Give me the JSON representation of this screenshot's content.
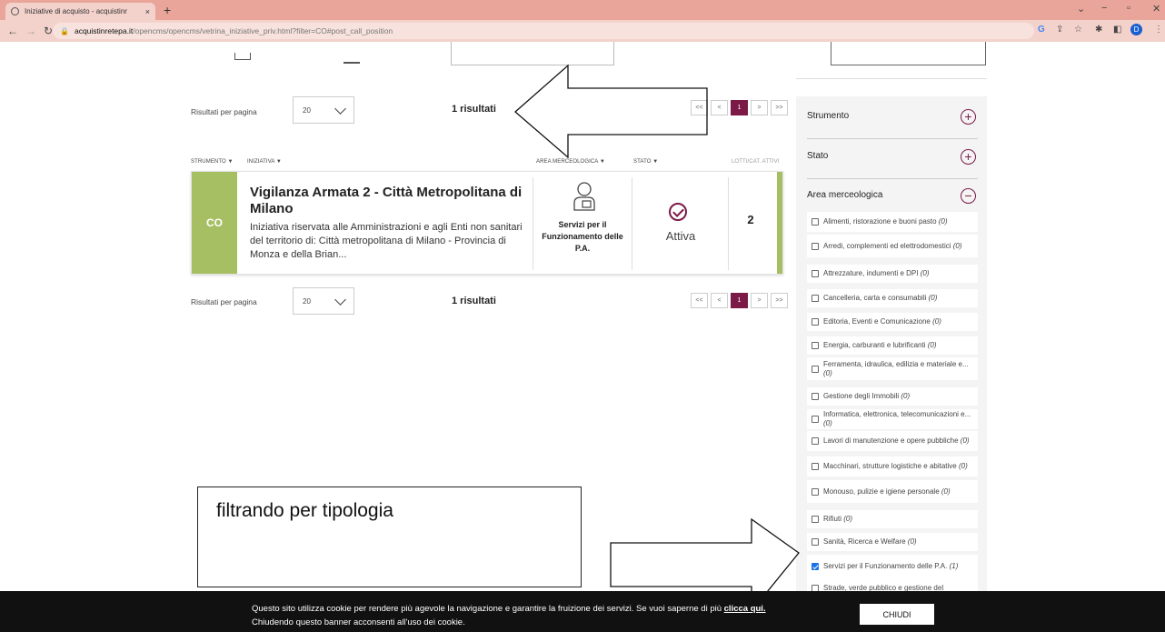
{
  "browser": {
    "tab_title": "Iniziative di acquisto - acquistinr",
    "tab_close": "×",
    "new_tab": "+",
    "url_domain": "acquistinretepa.it",
    "url_path": "/opencms/opencms/vetrina_iniziative_priv.html?filter=CO#post_call_position",
    "profile_initial": "D"
  },
  "results": {
    "per_page_label": "Risultati per pagina",
    "per_page_value": "20",
    "count_label": "1 risultati",
    "pager": [
      "<<",
      "<",
      "1",
      ">",
      ">>"
    ],
    "current_page": "1"
  },
  "columns": {
    "strumento": "STRUMENTO ▼",
    "iniziativa": "INIZIATIVA ▼",
    "area": "AREA MERCEOLOGICA ▼",
    "stato": "STATO ▼",
    "lotti": "LOTTI/CAT. ATTIVI"
  },
  "initiative": {
    "badge": "CO",
    "title": "Vigilanza Armata 2 - Città Metropolitana di Milano",
    "description": "Iniziativa riservata alle Amministrazioni e agli Enti non sanitari del territorio di: Città metropolitana di Milano - Provincia di Monza e della Brian...",
    "area": "Servizi per il Funzionamento delle P.A.",
    "stato": "Attiva",
    "lotti": "2"
  },
  "sidebar": {
    "facets": [
      {
        "label": "Strumento",
        "toggle": "+"
      },
      {
        "label": "Stato",
        "toggle": "+"
      },
      {
        "label": "Area merceologica",
        "toggle": "−"
      }
    ],
    "options": [
      {
        "label": "Alimenti, ristorazione e buoni pasto",
        "count": "(0)",
        "checked": false
      },
      {
        "label": "Arredi, complementi ed elettrodomestici",
        "count": "(0)",
        "checked": false
      },
      {
        "label": "Attrezzature, indumenti e DPI",
        "count": "(0)",
        "checked": false
      },
      {
        "label": "Cancelleria, carta e consumabili",
        "count": "(0)",
        "checked": false
      },
      {
        "label": "Editoria, Eventi e Comunicazione",
        "count": "(0)",
        "checked": false
      },
      {
        "label": "Energia, carburanti e lubrificanti",
        "count": "(0)",
        "checked": false
      },
      {
        "label": "Ferramenta, idraulica, edilizia e materiale e...",
        "count": "(0)",
        "checked": false
      },
      {
        "label": "Gestione degli Immobili",
        "count": "(0)",
        "checked": false
      },
      {
        "label": "Informatica, elettronica, telecomunicazioni e...",
        "count": "(0)",
        "checked": false
      },
      {
        "label": "Lavori di manutenzione e opere pubbliche",
        "count": "(0)",
        "checked": false
      },
      {
        "label": "Macchinari, strutture logistiche e abitative",
        "count": "(0)",
        "checked": false
      },
      {
        "label": "Monouso, pulizie e igiene personale",
        "count": "(0)",
        "checked": false
      },
      {
        "label": "Rifiuti",
        "count": "(0)",
        "checked": false
      },
      {
        "label": "Sanità, Ricerca e Welfare",
        "count": "(0)",
        "checked": false
      },
      {
        "label": "Servizi per il Funzionamento delle P.A.",
        "count": "(1)",
        "checked": true
      },
      {
        "label": "Strade, verde pubblico e gestione del",
        "count": "",
        "checked": false
      }
    ]
  },
  "annotation": {
    "text": "filtrando per tipologia"
  },
  "cookie": {
    "text": "Questo sito utilizza cookie per rendere più agevole la navigazione e garantire la fruizione dei servizi. Se vuoi saperne di più",
    "link": "clicca qui.",
    "text2": "Chiudendo questo banner acconsenti all'uso dei cookie.",
    "button": "CHIUDI"
  },
  "colors": {
    "accent": "#7b1a46",
    "badge_green": "#a6bf63",
    "chrome": "#e9a59a"
  }
}
